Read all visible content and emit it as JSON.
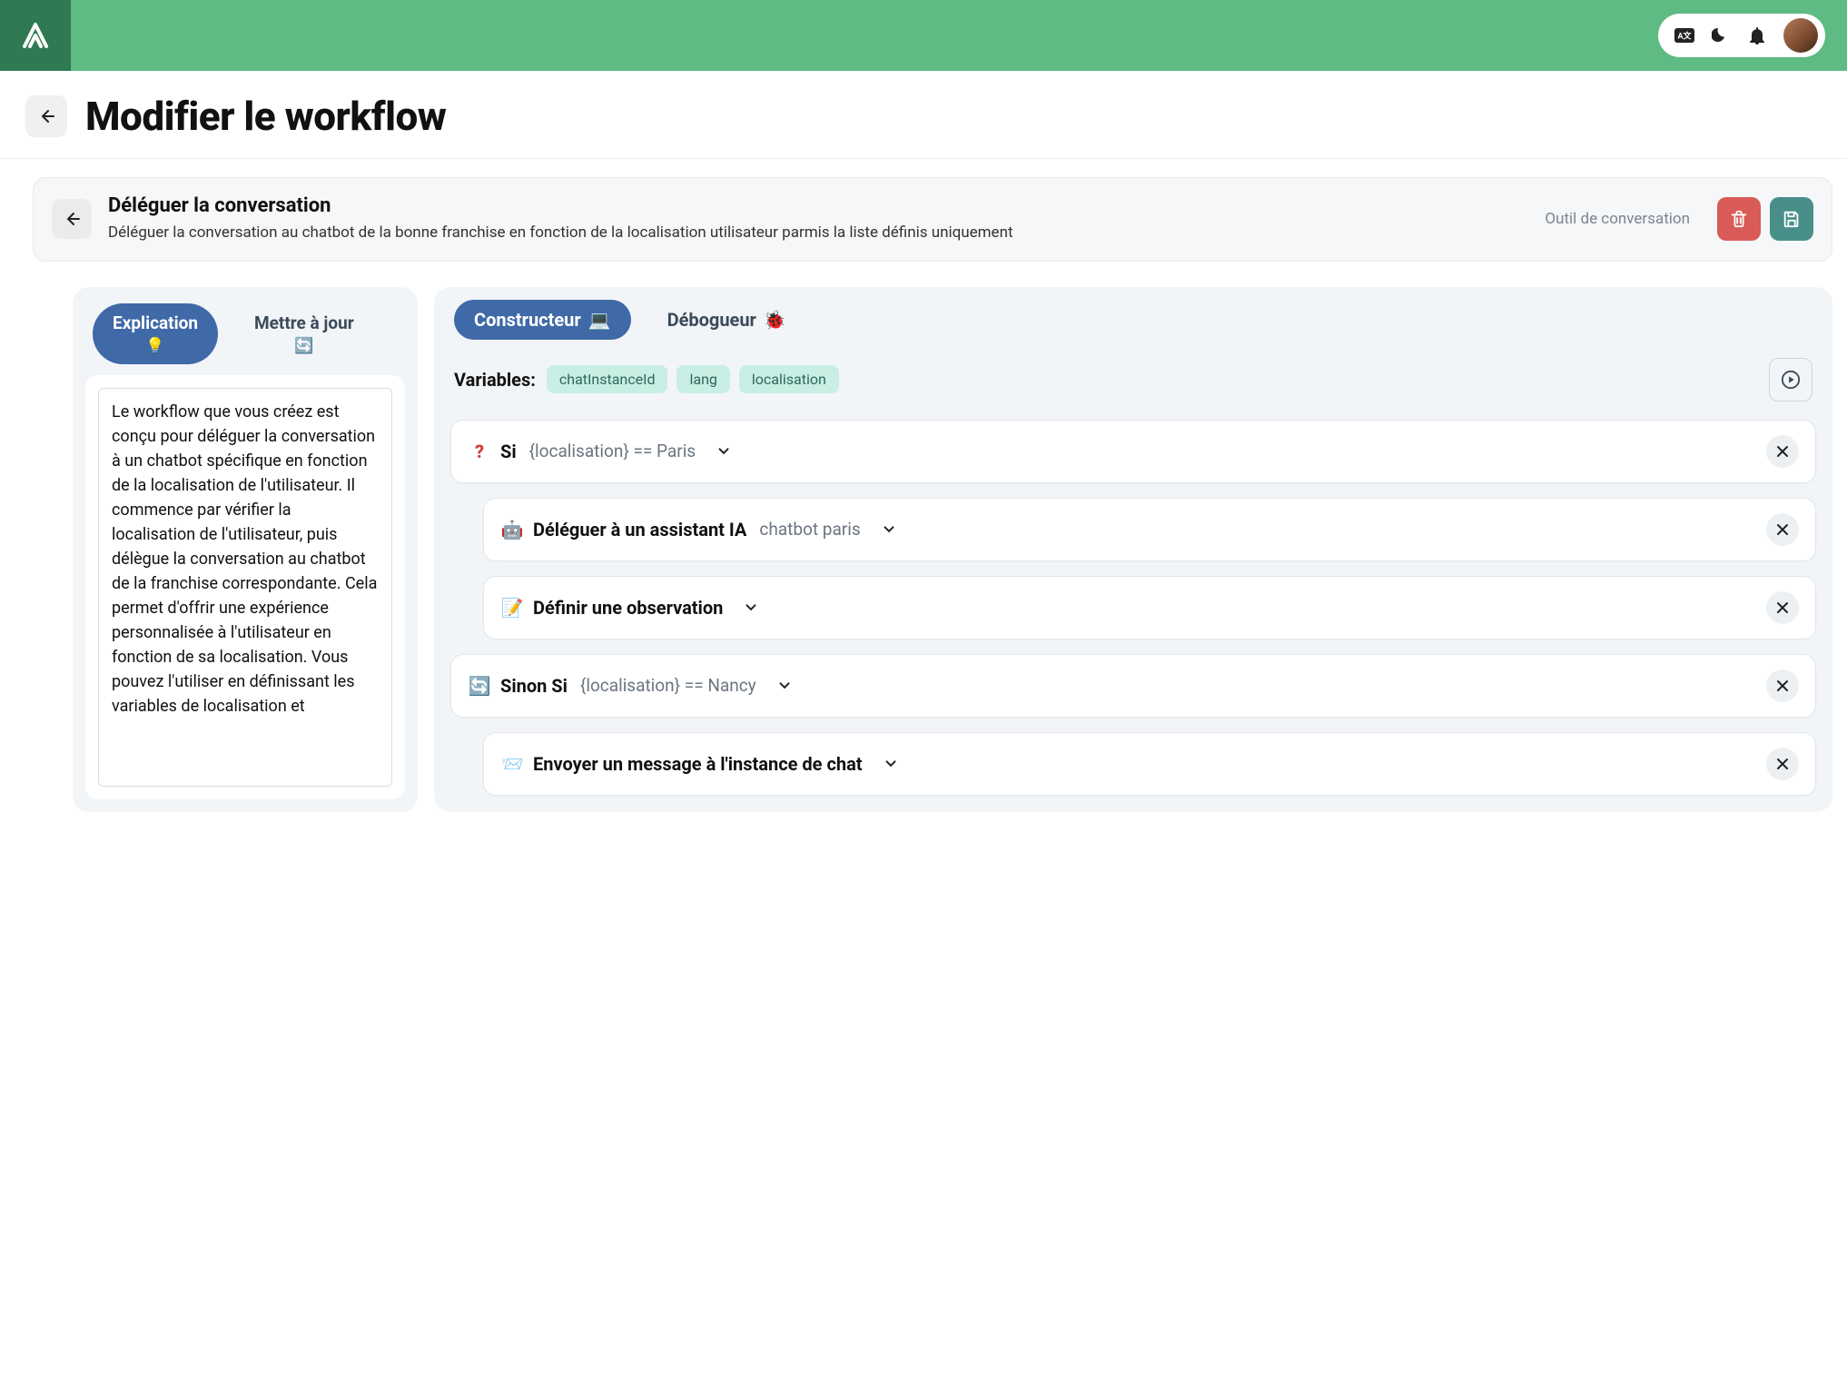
{
  "topbar": {
    "icons": {
      "translate": "translate-icon",
      "dark_mode": "moon-icon",
      "notifications": "bell-icon"
    }
  },
  "page": {
    "title": "Modifier le workflow"
  },
  "workflow": {
    "title": "Déléguer la conversation",
    "description": "Déléguer la conversation au chatbot de la bonne franchise en fonction de la localisation utilisateur parmis la liste définis uniquement",
    "badge": "Outil de conversation"
  },
  "left_panel": {
    "tabs": [
      {
        "label": "Explication",
        "emoji": "💡",
        "active": true
      },
      {
        "label": "Mettre à jour",
        "emoji": "🔄",
        "active": false
      }
    ],
    "explanation_text": "Le workflow que vous créez est conçu pour déléguer la conversation à un chatbot spécifique en fonction de la localisation de l'utilisateur. Il commence par vérifier la localisation de l'utilisateur, puis délègue la conversation au chatbot de la franchise correspondante. Cela permet d'offrir une expérience personnalisée à l'utilisateur en fonction de sa localisation. Vous pouvez l'utiliser en définissant les variables de localisation et"
  },
  "right_panel": {
    "tabs": [
      {
        "label": "Constructeur",
        "emoji": "💻",
        "active": true
      },
      {
        "label": "Débogueur",
        "emoji": "🐞",
        "active": false
      }
    ],
    "variables_label": "Variables:",
    "variables": [
      "chatInstanceId",
      "lang",
      "localisation"
    ],
    "steps": [
      {
        "icon": "?",
        "icon_kind": "red",
        "title": "Si",
        "meta": "{localisation} == Paris",
        "indent": false,
        "has_chevron": true
      },
      {
        "icon": "🤖",
        "icon_kind": "emoji",
        "title": "Déléguer à un assistant IA",
        "meta": "chatbot paris",
        "indent": true,
        "has_chevron": true
      },
      {
        "icon": "📝",
        "icon_kind": "emoji",
        "title": "Définir une observation",
        "meta": "",
        "indent": true,
        "has_chevron": true
      },
      {
        "icon": "🔄",
        "icon_kind": "emoji",
        "title": "Sinon Si",
        "meta": "{localisation} == Nancy",
        "indent": false,
        "has_chevron": true
      },
      {
        "icon": "📨",
        "icon_kind": "emoji",
        "title": "Envoyer un message à l'instance de chat",
        "meta": "",
        "indent": true,
        "has_chevron": true
      }
    ]
  }
}
